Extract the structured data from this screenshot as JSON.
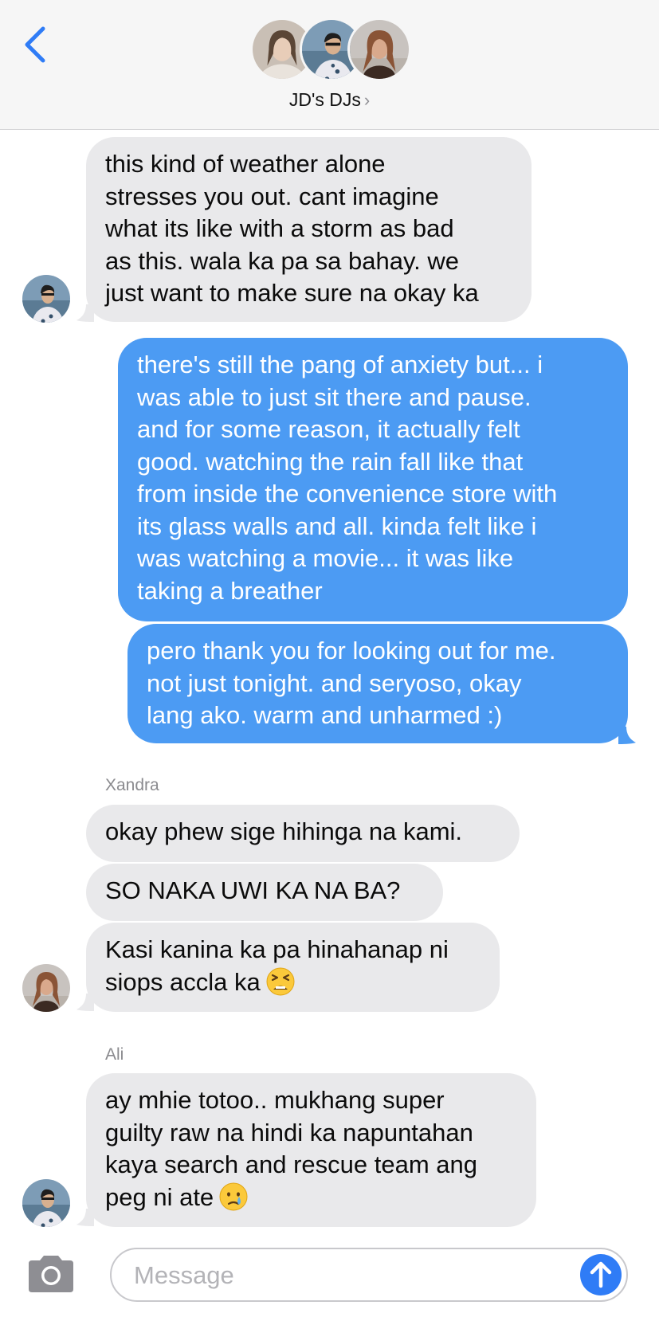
{
  "header": {
    "group_name": "JD's DJs",
    "chevron": "›",
    "back_icon": "chevron-left-icon",
    "accent": "#2f7cf6"
  },
  "messages": [
    {
      "from": "incoming",
      "lines": [
        "this kind of weather alone",
        "stresses you out. cant imagine",
        "what its like with a storm as bad",
        "as this. wala ka pa sa bahay. we",
        "just want to make sure na okay ka"
      ]
    },
    {
      "from": "outgoing",
      "lines": [
        "there's still the pang of anxiety but... i",
        "was able to just sit there and pause.",
        "and for some reason, it actually felt",
        "good. watching the rain fall like that",
        "from inside the convenience store with",
        "its glass walls and all. kinda felt like i",
        "was watching a movie... it was like",
        "taking a breather"
      ]
    },
    {
      "from": "outgoing",
      "lines": [
        "pero thank you for looking out for me.",
        "not just tonight. and seryoso, okay",
        "lang ako. warm and unharmed :)"
      ]
    },
    {
      "sender": "Xandra",
      "from": "incoming",
      "lines": [
        "okay phew sige hihinga na kami."
      ]
    },
    {
      "from": "incoming",
      "lines": [
        "SO NAKA UWI KA NA BA?"
      ]
    },
    {
      "from": "incoming",
      "lines": [
        "Kasi kanina ka pa hinahanap ni",
        "siops accla ka"
      ],
      "emoji": "tired-face-emoji"
    },
    {
      "sender": "Ali",
      "from": "incoming",
      "lines": [
        "ay mhie totoo.. mukhang super",
        "guilty raw na hindi ka napuntahan",
        "kaya search and rescue team ang",
        "peg ni ate"
      ],
      "emoji": "crying-face-emoji"
    }
  ],
  "input": {
    "placeholder": "Message",
    "camera_icon": "camera-icon",
    "send_icon": "arrow-up-icon"
  },
  "colors": {
    "incoming_bubble": "#e9e9eb",
    "outgoing_bubble": "#4c9bf3",
    "header_bg": "#f6f6f6"
  }
}
